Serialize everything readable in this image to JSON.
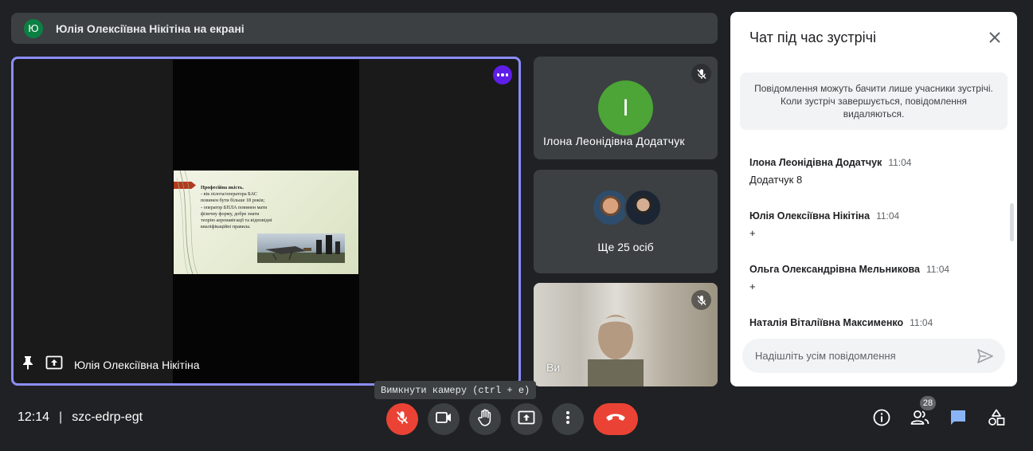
{
  "banner": {
    "avatar_letter": "Ю",
    "text": "Юлія Олексіївна Нікітіна на екрані"
  },
  "main_tile": {
    "presenter_name": "Юлія Олексіївна Нікітіна",
    "slide": {
      "heading": "Професійна якість.",
      "lines": [
        "- вік пілота/оператора БАС",
        "повинен бути більше 18 років;",
        "- оператор БПЛА повинен мати",
        "фізичну форму, добре знати",
        "теорію аеронавігації та відповідні",
        "кваліфікаційні правила."
      ]
    }
  },
  "tiles": {
    "tile1": {
      "avatar_letter": "І",
      "name": "Ілона Леонідівна Додатчук",
      "avatar_color": "#4ca536"
    },
    "tile2": {
      "more_label": "Ще 25 осіб"
    },
    "tile3": {
      "name": "Ви"
    }
  },
  "tooltip": "Вимкнути камеру (ctrl + e)",
  "chat": {
    "title": "Чат під час зустрічі",
    "notice": "Повідомлення можуть бачити лише учасники зустрічі. Коли зустріч завершується, повідомлення видаляються.",
    "messages": [
      {
        "sender": "Ілона Леонідівна Додатчук",
        "time": "11:04",
        "text": "Додатчук 8"
      },
      {
        "sender": "Юлія Олексіївна Нікітіна",
        "time": "11:04",
        "text": "+"
      },
      {
        "sender": "Ольга Олександрівна Мельникова",
        "time": "11:04",
        "text": "+"
      },
      {
        "sender": "Наталія Віталіївна Максименко",
        "time": "11:04",
        "text": ""
      }
    ],
    "input_placeholder": "Надішліть усім повідомлення"
  },
  "bottom_bar": {
    "time": "12:14",
    "separator": "|",
    "meeting_code": "szc-edrp-egt",
    "participants_count": "28"
  },
  "colors": {
    "accent_purple": "#8c8df8",
    "end_call_red": "#ea4335",
    "chat_active_blue": "#8ab4f8",
    "background": "#202124"
  }
}
